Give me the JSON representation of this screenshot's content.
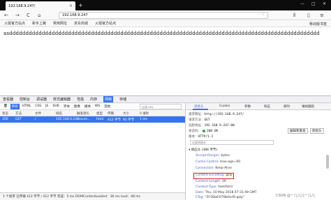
{
  "browser": {
    "tab_title": "192.168.9.247/",
    "tab_close": "×",
    "new_tab": "+",
    "win_min": "—",
    "win_max": "□",
    "win_close": "✕",
    "back": "←",
    "forward": "→",
    "reload": "C",
    "home": "⌂",
    "url": "192.168.9.247",
    "url_more": "··· ☆",
    "bookmarks": [
      "火狐官方站点",
      "新手上路",
      "常用网址",
      "京东商城",
      "火狐官方站点"
    ],
    "bookmarks_right": "移动版书签"
  },
  "page": {
    "content": "asddddddddddddddddddddddddddddddddddddddddddddddddddddddddddddddddddddddddddddddddddddddddddddddd"
  },
  "devtools": {
    "tools": [
      "查看器",
      "控制台",
      "调试器",
      "样式编辑器",
      "性能",
      "内存",
      "网络",
      "存储"
    ],
    "active_tool": "网络",
    "filters": [
      "所有",
      "HTML",
      "CSS",
      "JS",
      "XHR",
      "字体",
      "图像",
      "媒体",
      "WS",
      "其他"
    ],
    "active_filter": "所有",
    "filter_placeholder": "过滤 URL",
    "columns": [
      "状态",
      "方法",
      "文件",
      "域名",
      "触发源头",
      "类型",
      "传输",
      "大小",
      "0 毫秒"
    ],
    "request": {
      "status": "200",
      "method": "GET",
      "file": "/",
      "domain": "192.168.9.247",
      "cause": "docum...",
      "type": "html",
      "transferred": "412 字节",
      "size": "95 字节",
      "timing": "1 ms"
    },
    "status_bar": "1 个请求  已传输 412 字节 / 412 字节  完成：5 ms  DOMContentLoaded：36 ms  load：48 ms"
  },
  "details": {
    "tabs": [
      "消息头",
      "Cookie",
      "参数",
      "响应",
      "耗时",
      "堆栈跟踪"
    ],
    "active_tab": "消息头",
    "request_url_label": "请求网址：",
    "request_url": "http://192.168.9.247/",
    "request_method_label": "请求方法：",
    "request_method": "GET",
    "remote_addr_label": "远程地址：",
    "remote_addr": "192.168.9.247:80",
    "status_code_label": "状态码：",
    "status_code": "200 OK",
    "edit_resend": "编辑和重发",
    "raw_headers": "原始头",
    "version_label": "版本：",
    "version": "HTTP/1.1",
    "filter_placeholder": "过滤消息头",
    "response_headers_title": "▾ 响应头 (386 字节)",
    "headers": [
      {
        "k": "Accept-Ranges: ",
        "v": "bytes"
      },
      {
        "k": "Cache-Control: ",
        "v": "max-age=60"
      },
      {
        "k": "Connection: ",
        "v": "Keep-Alive"
      },
      {
        "k": "Content-Encoding: ",
        "v": "gzip"
      },
      {
        "k": "Content-Length: ",
        "v": "26"
      },
      {
        "k": "Content-Type: ",
        "v": "text/html"
      },
      {
        "k": "Date: ",
        "v": "Thu, 10 May 2018 07:31:49 GMT"
      },
      {
        "k": "ETag: ",
        "v": "\"5f-56b01f78bfecf0-gzip\""
      }
    ],
    "watermark": "CSDN @一儿儿儿一儿儿"
  }
}
